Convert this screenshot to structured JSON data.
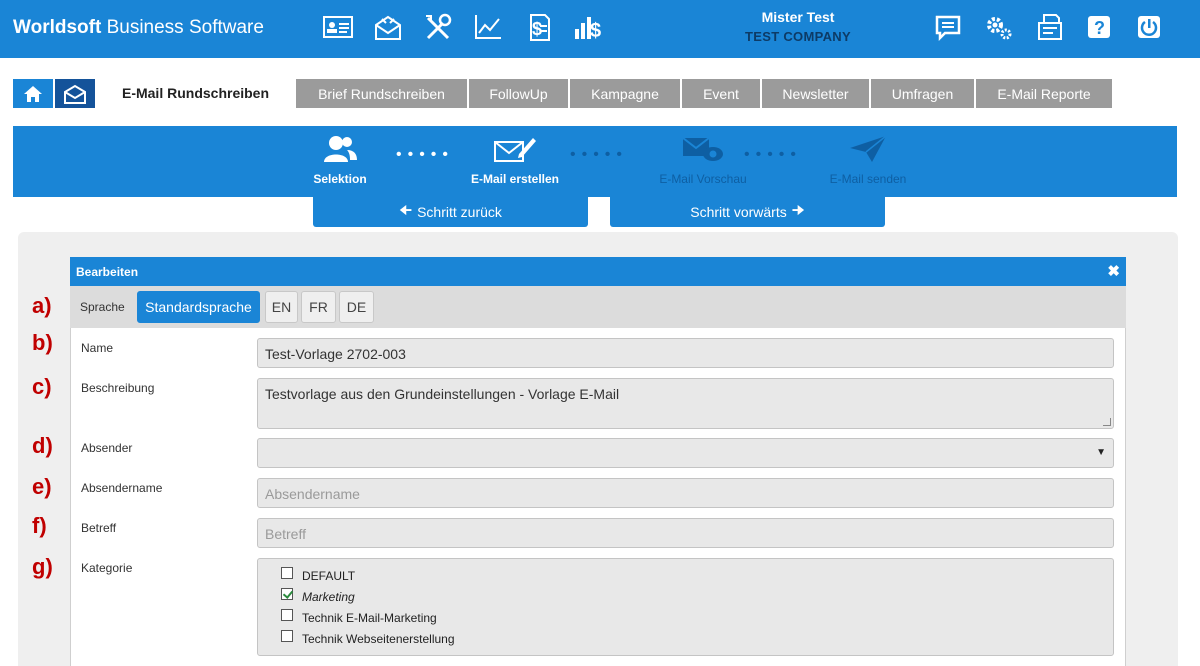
{
  "app": {
    "brand_bold": "Worldsoft",
    "brand_rest": " Business Software"
  },
  "user": {
    "name": "Mister Test",
    "company": "TEST COMPANY"
  },
  "top_icons_left": [
    "contact-card-icon",
    "mail-settings-icon",
    "tools-icon",
    "chart-line-icon",
    "invoice-icon",
    "sales-chart-icon"
  ],
  "top_icons_right": [
    "chat-icon",
    "settings-gears-icon",
    "fax-icon",
    "help-icon",
    "power-icon"
  ],
  "tabs": [
    {
      "label": "E-Mail Rundschreiben",
      "active": true
    },
    {
      "label": "Brief Rundschreiben"
    },
    {
      "label": "FollowUp"
    },
    {
      "label": "Kampagne"
    },
    {
      "label": "Event"
    },
    {
      "label": "Newsletter"
    },
    {
      "label": "Umfragen"
    },
    {
      "label": "E-Mail Reporte"
    }
  ],
  "wizard": {
    "steps": [
      {
        "label": "Selektion",
        "icon": "users-icon",
        "done": true
      },
      {
        "label": "E-Mail erstellen",
        "icon": "mail-edit-icon",
        "done": true
      },
      {
        "label": "E-Mail Vorschau",
        "icon": "mail-preview-icon",
        "done": false
      },
      {
        "label": "E-Mail senden",
        "icon": "send-icon",
        "done": false
      }
    ],
    "back_label": "Schritt zurück",
    "next_label": "Schritt vorwärts"
  },
  "dialog": {
    "title": "Bearbeiten",
    "close": "✖",
    "language_label": "Sprache",
    "languages": [
      "Standardsprache",
      "EN",
      "FR",
      "DE"
    ],
    "active_language": "Standardsprache",
    "markers": [
      "a)",
      "b)",
      "c)",
      "d)",
      "e)",
      "f)",
      "g)"
    ],
    "fields": {
      "name": {
        "label": "Name",
        "value": "Test-Vorlage 2702-003"
      },
      "description": {
        "label": "Beschreibung",
        "value": "Testvorlage aus den Grundeinstellungen - Vorlage E-Mail"
      },
      "sender": {
        "label": "Absender",
        "value": ""
      },
      "sender_name": {
        "label": "Absendername",
        "placeholder": "Absendername"
      },
      "subject": {
        "label": "Betreff",
        "placeholder": "Betreff"
      },
      "category": {
        "label": "Kategorie",
        "options": [
          {
            "label": "DEFAULT",
            "checked": false
          },
          {
            "label": "Marketing",
            "checked": true
          },
          {
            "label": "Technik E-Mail-Marketing",
            "checked": false
          },
          {
            "label": "Technik Webseitenerstellung",
            "checked": false
          }
        ]
      }
    }
  },
  "colors": {
    "primary": "#1a85d6",
    "dark_blue": "#14539a",
    "tab_grey": "#9b9b9b",
    "marker_red": "#c00000"
  }
}
